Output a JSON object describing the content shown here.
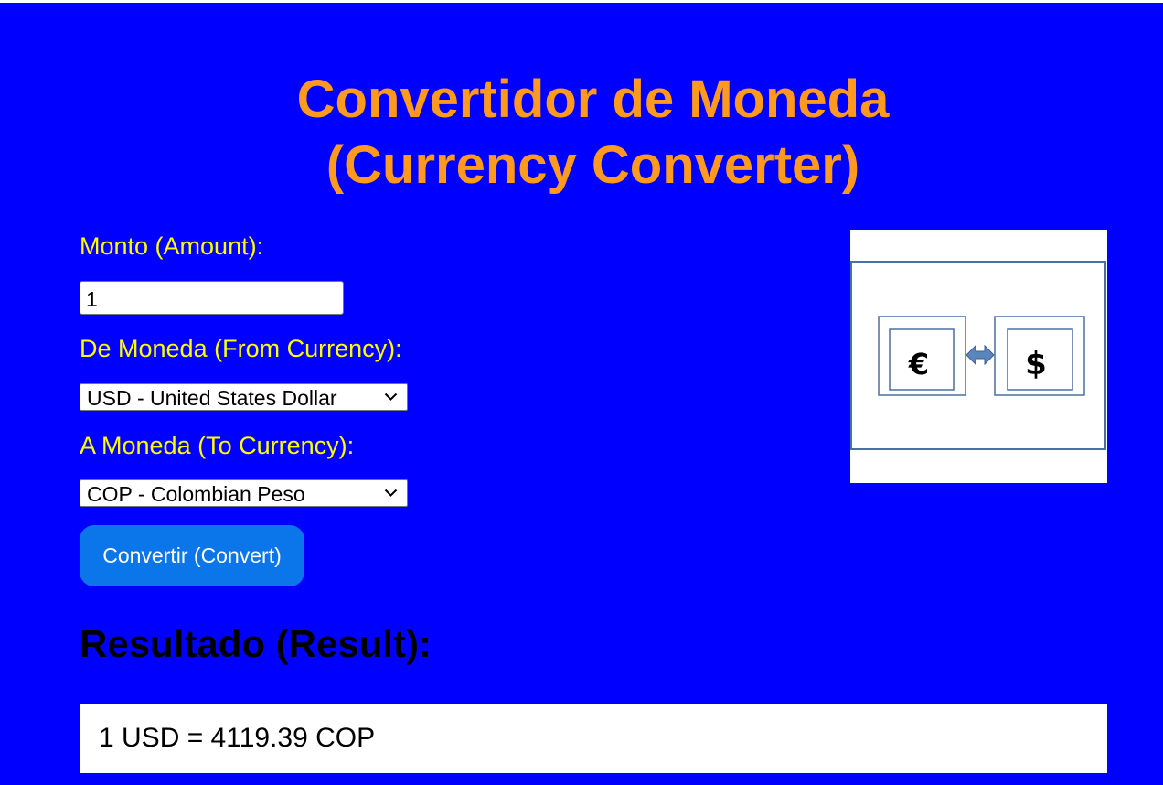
{
  "page": {
    "title_line1": "Convertidor de Moneda",
    "title_line2": "(Currency Converter)",
    "colors": {
      "background": "#0000ff",
      "title": "#ff9a1f",
      "labels": "#ffff00",
      "button": "#0a76ea"
    }
  },
  "form": {
    "amount_label": "Monto (Amount):",
    "amount_value": "1",
    "from_label": "De Moneda (From Currency):",
    "from_selected": "USD - United States Dollar",
    "to_label": "A Moneda (To Currency):",
    "to_selected": "COP - Colombian Peso",
    "convert_label": "Convertir (Convert)"
  },
  "result": {
    "heading": "Resultado (Result):",
    "text": "1 USD = 4119.39 COP"
  },
  "illustration": {
    "left_symbol": "€",
    "right_symbol": "$",
    "icons": [
      "euro-icon",
      "swap-arrows-icon",
      "dollar-icon"
    ]
  }
}
